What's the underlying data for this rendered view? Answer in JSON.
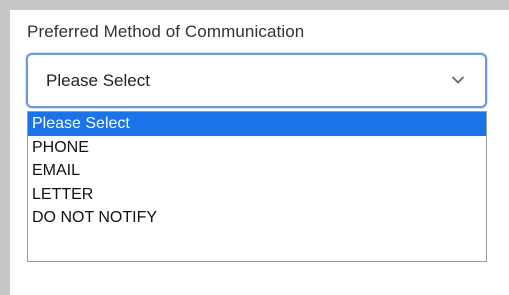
{
  "field": {
    "label": "Preferred Method of Communication",
    "selected_value": "Please Select"
  },
  "dropdown": {
    "options": [
      {
        "label": "Please Select",
        "selected": true
      },
      {
        "label": "PHONE",
        "selected": false
      },
      {
        "label": "EMAIL",
        "selected": false
      },
      {
        "label": "LETTER",
        "selected": false
      },
      {
        "label": "DO NOT NOTIFY",
        "selected": false
      }
    ]
  },
  "icons": {
    "chevron": "chevron-down-icon"
  },
  "colors": {
    "highlight": "#1a73e8",
    "focus_border": "#6b9ad6"
  }
}
